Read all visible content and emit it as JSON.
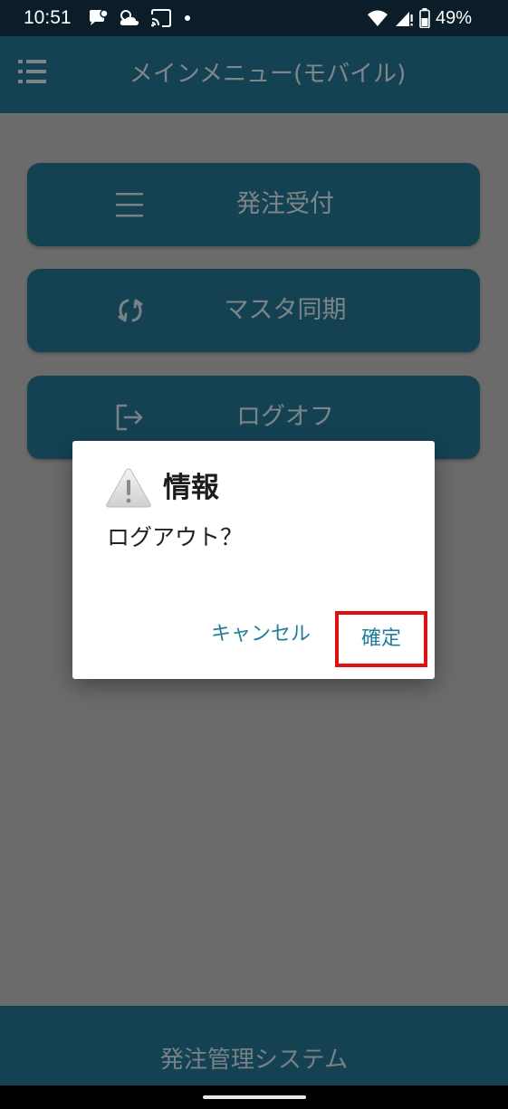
{
  "status_bar": {
    "time": "10:51",
    "battery": "49%",
    "icons": [
      "chat-notification-icon",
      "weather-icon",
      "cast-icon",
      "dot-icon",
      "wifi-icon",
      "signal-icon",
      "battery-icon"
    ]
  },
  "app_bar": {
    "title": "メインメニュー(モバイル)",
    "menu_icon": "hamburger-list-icon"
  },
  "menu": {
    "items": [
      {
        "label": "発注受付",
        "icon": "list-lines-icon"
      },
      {
        "label": "マスタ同期",
        "icon": "sync-icon"
      },
      {
        "label": "ログオフ",
        "icon": "logout-icon"
      }
    ]
  },
  "footer": {
    "title": "発注管理システム"
  },
  "dialog": {
    "title": "情報",
    "message": "ログアウト？",
    "cancel_label": "キャンセル",
    "confirm_label": "確定",
    "icon": "warning-icon"
  },
  "colors": {
    "status_bar": "#0a1d29",
    "primary": "#24738f",
    "background": "#b8b8b8",
    "dialog_button_text": "#1f7f9a",
    "highlight_border": "#e01010"
  }
}
